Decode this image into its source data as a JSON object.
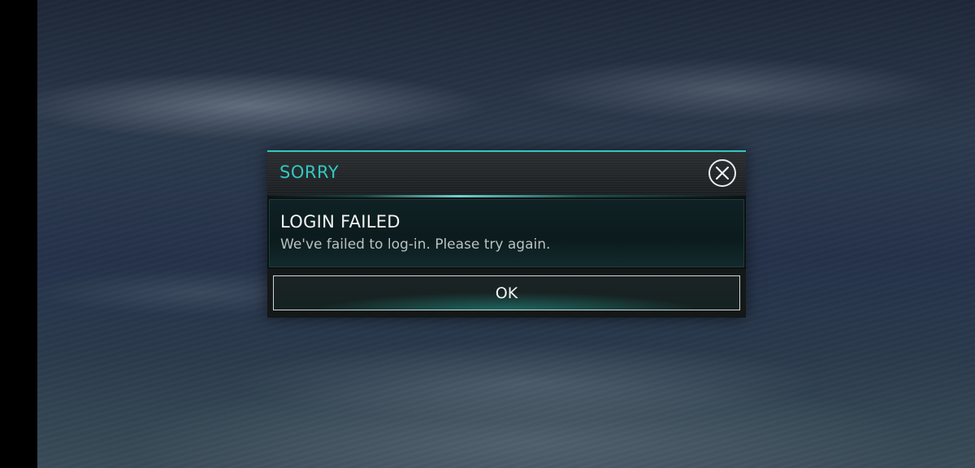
{
  "dialog": {
    "title": "SORRY",
    "heading": "LOGIN FAILED",
    "message": "We've failed to log-in. Please try again.",
    "ok_label": "OK",
    "close_icon": "close-icon"
  },
  "colors": {
    "accent": "#34c7c0",
    "heading_text": "#f2f4f4",
    "message_text": "#b9c2c3"
  }
}
